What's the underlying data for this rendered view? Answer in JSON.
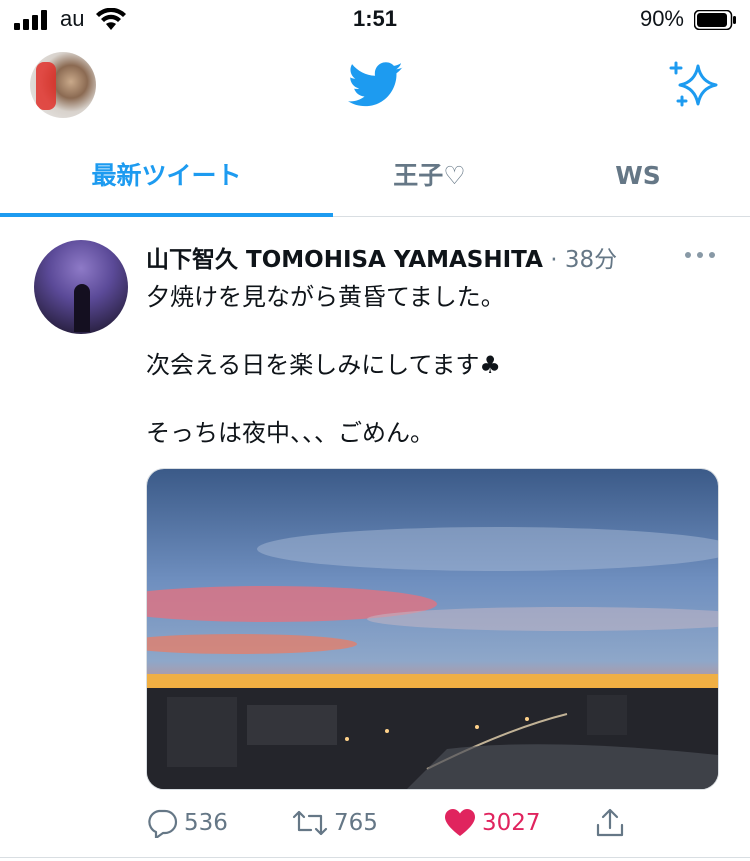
{
  "status_bar": {
    "carrier": "au",
    "time": "1:51",
    "battery": "90%"
  },
  "header": {
    "logo_icon": "twitter-bird-icon",
    "sparkle_icon": "sparkle-icon"
  },
  "tabs": [
    {
      "label": "最新ツイート",
      "active": true
    },
    {
      "label": "王子♡",
      "active": false
    },
    {
      "label": "WS",
      "active": false
    }
  ],
  "tweet": {
    "name": "山下智久 TOMOHISA YAMASHITA",
    "time": "38分",
    "lines": [
      "夕焼けを見ながら黄昏てました。",
      "",
      "次会える日を楽しみにしてます♣",
      "",
      "そっちは夜中、、、ごめん。"
    ],
    "replies": "536",
    "retweets": "765",
    "likes": "3027"
  },
  "colors": {
    "accent": "#1d9bf0",
    "like": "#e0245e",
    "muted": "#657786"
  }
}
